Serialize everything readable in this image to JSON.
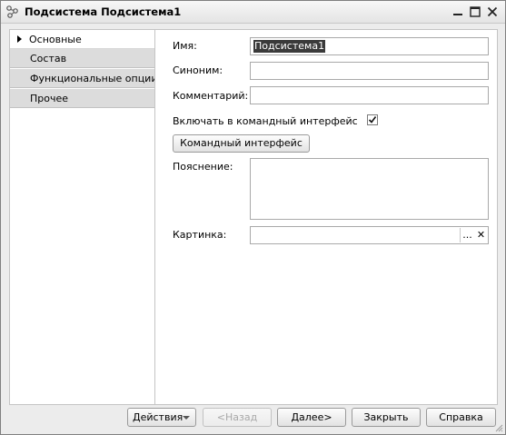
{
  "window": {
    "title": "Подсистема Подсистема1"
  },
  "sidebar": {
    "tabs": [
      {
        "label": "Основные"
      },
      {
        "label": "Состав"
      },
      {
        "label": "Функциональные опции"
      },
      {
        "label": "Прочее"
      }
    ]
  },
  "form": {
    "name_label": "Имя:",
    "name_value": "Подсистема1",
    "synonym_label": "Синоним:",
    "synonym_value": "",
    "comment_label": "Комментарий:",
    "comment_value": "",
    "include_label": "Включать в командный интерфейс",
    "include_checked": true,
    "command_interface_button": "Командный интерфейс",
    "explanation_label": "Пояснение:",
    "explanation_value": "",
    "picture_label": "Картинка:",
    "picture_value": "",
    "picture_select_glyph": "...",
    "picture_clear_glyph": "✕"
  },
  "footer": {
    "actions_label": "Действия",
    "back_label": "<Назад",
    "next_label": "Далее>",
    "close_label": "Закрыть",
    "help_label": "Справка"
  }
}
